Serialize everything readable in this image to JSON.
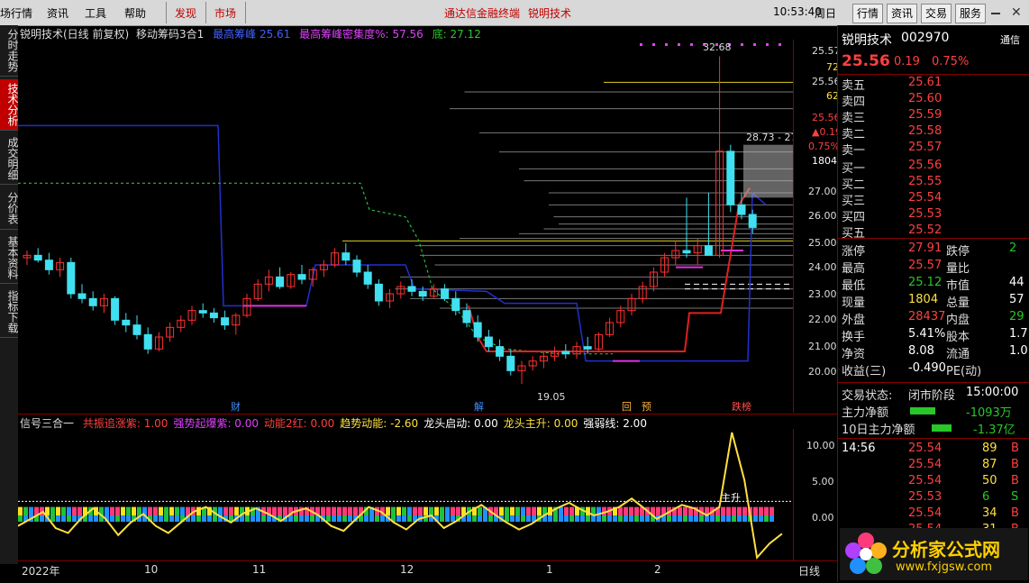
{
  "menubar": {
    "items": [
      "场行情",
      "资讯",
      "工具",
      "帮助"
    ],
    "discover": "发现",
    "market": "市场",
    "banner": "通达信金融终端",
    "stock_title": "锐明技术",
    "time": "10:53:40",
    "weekday": "周日",
    "right_buttons": [
      "行情",
      "资讯",
      "交易",
      "服务"
    ]
  },
  "left_tabs": [
    "分时走势",
    "技术分析",
    "成交明细",
    "分价表",
    "基本资料",
    "指标下载"
  ],
  "main_chart": {
    "header_name": "锐明技术(日线 前复权)",
    "indicator": "移动筹码3合1",
    "cost_label": "最高筹峰",
    "cost_value": "25.61",
    "density_label": "最高筹峰密集度%:",
    "density_value": "57.56",
    "bottom_label": "底:",
    "bottom_value": "27.12",
    "peak_label": "32.68",
    "low_label": "19.05",
    "range_label": "28.73 - 27",
    "axis_ticks": [
      "27.00",
      "26.00",
      "25.00",
      "24.00",
      "23.00",
      "22.00",
      "21.00",
      "20.00"
    ],
    "axis_top": [
      "25.57",
      "72",
      "25.56",
      "62",
      "25.56",
      "▲0.19",
      "0.75%",
      "1804"
    ],
    "event_tags": [
      "财",
      "解",
      "回",
      "预",
      "跌榜"
    ]
  },
  "chart_data": {
    "type": "candlestick",
    "ohlc": [
      [
        24.3,
        24.6,
        24.0,
        24.4
      ],
      [
        24.4,
        24.7,
        24.1,
        24.2
      ],
      [
        24.2,
        24.5,
        23.6,
        23.8
      ],
      [
        23.8,
        24.3,
        23.5,
        24.1
      ],
      [
        24.1,
        24.3,
        22.6,
        22.8
      ],
      [
        22.8,
        23.2,
        22.4,
        22.6
      ],
      [
        22.6,
        22.9,
        22.1,
        22.3
      ],
      [
        22.3,
        22.8,
        22.0,
        22.6
      ],
      [
        22.6,
        22.7,
        21.5,
        21.7
      ],
      [
        21.7,
        22.0,
        21.2,
        21.5
      ],
      [
        21.5,
        21.9,
        20.9,
        21.1
      ],
      [
        21.1,
        21.4,
        20.3,
        20.5
      ],
      [
        20.5,
        21.2,
        20.4,
        21.0
      ],
      [
        21.0,
        21.6,
        20.8,
        21.4
      ],
      [
        21.4,
        21.9,
        21.2,
        21.7
      ],
      [
        21.7,
        22.3,
        21.5,
        22.1
      ],
      [
        22.1,
        22.4,
        21.8,
        22.0
      ],
      [
        22.0,
        22.2,
        21.6,
        21.8
      ],
      [
        21.8,
        22.1,
        21.3,
        21.5
      ],
      [
        21.5,
        22.0,
        21.1,
        21.9
      ],
      [
        21.9,
        22.8,
        21.8,
        22.6
      ],
      [
        22.6,
        23.4,
        22.5,
        23.2
      ],
      [
        23.2,
        23.8,
        22.9,
        23.5
      ],
      [
        23.5,
        23.9,
        23.0,
        23.1
      ],
      [
        23.1,
        23.7,
        23.0,
        23.6
      ],
      [
        23.6,
        24.0,
        23.2,
        23.4
      ],
      [
        23.4,
        23.9,
        23.1,
        23.8
      ],
      [
        23.8,
        24.2,
        23.5,
        24.0
      ],
      [
        24.0,
        24.7,
        23.9,
        24.5
      ],
      [
        24.5,
        24.9,
        24.0,
        24.2
      ],
      [
        24.2,
        24.4,
        23.5,
        23.7
      ],
      [
        23.7,
        24.0,
        23.0,
        23.2
      ],
      [
        23.2,
        23.4,
        22.3,
        22.5
      ],
      [
        22.5,
        23.0,
        22.2,
        22.8
      ],
      [
        22.8,
        23.3,
        22.6,
        23.1
      ],
      [
        23.1,
        23.4,
        22.7,
        22.9
      ],
      [
        22.9,
        23.1,
        22.5,
        22.7
      ],
      [
        22.7,
        23.2,
        22.6,
        23.0
      ],
      [
        23.0,
        23.2,
        22.5,
        22.6
      ],
      [
        22.6,
        22.9,
        21.9,
        22.1
      ],
      [
        22.1,
        22.4,
        21.4,
        21.6
      ],
      [
        21.6,
        21.9,
        20.8,
        21.0
      ],
      [
        21.0,
        21.3,
        20.4,
        20.6
      ],
      [
        20.6,
        20.9,
        20.0,
        20.2
      ],
      [
        20.2,
        20.5,
        19.4,
        19.6
      ],
      [
        19.6,
        20.0,
        19.05,
        19.8
      ],
      [
        19.8,
        20.2,
        19.6,
        20.0
      ],
      [
        20.0,
        20.4,
        19.7,
        20.2
      ],
      [
        20.2,
        20.6,
        20.0,
        20.4
      ],
      [
        20.4,
        20.7,
        20.1,
        20.3
      ],
      [
        20.3,
        20.8,
        20.1,
        20.6
      ],
      [
        20.6,
        21.0,
        20.3,
        20.5
      ],
      [
        20.5,
        21.2,
        20.4,
        21.1
      ],
      [
        21.1,
        21.8,
        21.0,
        21.6
      ],
      [
        21.6,
        22.3,
        21.4,
        22.1
      ],
      [
        22.1,
        22.8,
        21.9,
        22.6
      ],
      [
        22.6,
        23.3,
        22.4,
        23.1
      ],
      [
        23.1,
        23.9,
        22.9,
        23.7
      ],
      [
        23.7,
        24.5,
        23.5,
        24.3
      ],
      [
        24.3,
        25.0,
        24.0,
        24.6
      ],
      [
        24.6,
        26.8,
        24.3,
        24.5
      ],
      [
        24.5,
        25.1,
        24.0,
        24.8
      ],
      [
        24.8,
        27.0,
        24.5,
        24.4
      ],
      [
        24.4,
        32.68,
        24.3,
        28.73
      ],
      [
        28.73,
        29.0,
        26.2,
        26.5
      ],
      [
        26.5,
        27.0,
        25.9,
        26.1
      ],
      [
        26.1,
        26.3,
        25.3,
        25.56
      ]
    ],
    "y_range": [
      18.6,
      33.0
    ]
  },
  "sub_chart": {
    "name": "信号三合一",
    "items": [
      {
        "label": "共振追涨紫:",
        "value": "1.00",
        "color": "#ff4040"
      },
      {
        "label": "强势起爆紫:",
        "value": "0.00",
        "color": "#e040ff"
      },
      {
        "label": "动能2红:",
        "value": "0.00",
        "color": "#ff4040"
      },
      {
        "label": "趋势动能:",
        "value": "-2.60",
        "color": "#ffe040"
      },
      {
        "label": "龙头启动:",
        "value": "0.00",
        "color": "#fff"
      },
      {
        "label": "龙头主升:",
        "value": "0.00",
        "color": "#ffe040"
      },
      {
        "label": "强弱线:",
        "value": "2.00",
        "color": "#fff"
      }
    ],
    "axis_ticks": [
      "10.00",
      "5.00",
      "0.00"
    ],
    "annotation": "主升"
  },
  "time_axis": [
    "2022年",
    "10",
    "11",
    "12",
    "1",
    "2"
  ],
  "period_label": "日线",
  "quote": {
    "name": "锐明技术",
    "code": "002970",
    "tab": "通信",
    "price": "25.56",
    "change": "0.19",
    "pct": "0.75%",
    "asks": [
      [
        "卖五",
        "25.61"
      ],
      [
        "卖四",
        "25.60"
      ],
      [
        "卖三",
        "25.59"
      ],
      [
        "卖二",
        "25.58"
      ],
      [
        "卖一",
        "25.57"
      ]
    ],
    "bids": [
      [
        "买一",
        "25.56"
      ],
      [
        "买二",
        "25.55"
      ],
      [
        "买三",
        "25.54"
      ],
      [
        "买四",
        "25.53"
      ],
      [
        "买五",
        "25.52"
      ]
    ],
    "stats": [
      [
        "涨停",
        "27.91",
        "跌停",
        "2"
      ],
      [
        "最高",
        "25.57",
        "量比",
        ""
      ],
      [
        "最低",
        "25.12",
        "市值",
        "44"
      ],
      [
        "现量",
        "1804",
        "总量",
        "57"
      ],
      [
        "外盘",
        "28437",
        "内盘",
        "29"
      ],
      [
        "换手",
        "5.41%",
        "股本",
        "1.7"
      ],
      [
        "净资",
        "8.08",
        "流通",
        "1.0"
      ],
      [
        "收益(三)",
        "-0.490",
        "PE(动)",
        ""
      ]
    ],
    "trade_status_label": "交易状态:",
    "trade_status": "闭市阶段",
    "trade_time": "15:00:00",
    "main_net_label": "主力净额",
    "main_net": "-1093万",
    "ten_day_label": "10日主力净额",
    "ten_day": "-1.37亿",
    "ticks": [
      [
        "14:56",
        "25.54",
        "89",
        "B"
      ],
      [
        "",
        "25.54",
        "87",
        "B"
      ],
      [
        "",
        "25.54",
        "50",
        "B"
      ],
      [
        "",
        "25.53",
        "6",
        "S"
      ],
      [
        "",
        "25.54",
        "34",
        "B"
      ],
      [
        "",
        "25.54",
        "31",
        "B"
      ]
    ],
    "logo_text": "分析家公式网",
    "logo_url": "www.fxjgsw.com"
  }
}
